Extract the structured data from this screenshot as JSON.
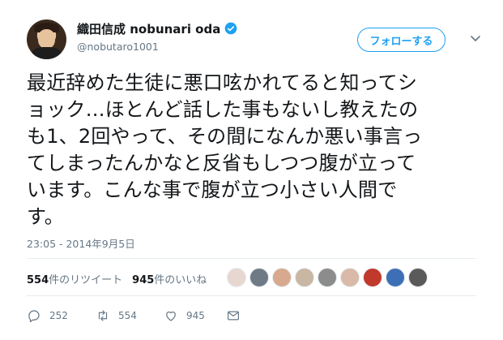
{
  "user": {
    "display_name": "織田信成 nobunari oda",
    "handle": "@nobutaro1001"
  },
  "follow_label": "フォローする",
  "tweet": {
    "lines": [
      "最近辞めた生徒に悪口呟かれてると知ってシ",
      "ョック…ほとんど話した事もないし教えたの",
      "も1、2回やって、その間になんか悪い事言っ",
      "てしまったんかなと反省もしつつ腹が立って",
      "います。こんな事で腹が立つ小さい人間で",
      "す。"
    ],
    "timestamp": "23:05 - 2014年9月5日"
  },
  "stats": {
    "retweets_count": "554",
    "retweets_label": "件のリツイート",
    "likes_count": "945",
    "likes_label": "件のいいね"
  },
  "likers": [
    "#e8d7d0",
    "#6e7a86",
    "#d7a98e",
    "#c9b7a3",
    "#8c8c8c",
    "#d9b9a8",
    "#c0392b",
    "#3d6fb6",
    "#5a5a5a"
  ],
  "actions": {
    "reply_count": "252",
    "retweet_count": "554",
    "like_count": "945"
  },
  "colors": {
    "accent": "#1da1f2",
    "muted": "#657786"
  }
}
